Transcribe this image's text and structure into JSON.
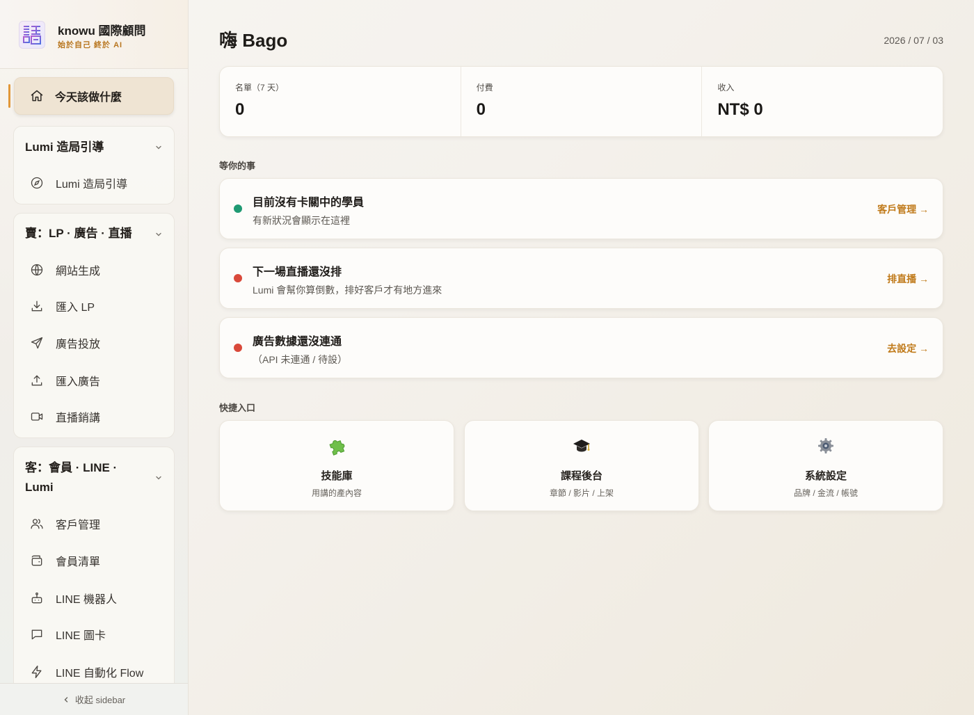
{
  "brand": {
    "logo_glyph": "譸",
    "name": "knowu 國際顧問",
    "tagline": "始於自己 終於 AI"
  },
  "sidebar": {
    "active_item": {
      "label": "今天該做什麼",
      "icon": "home-icon"
    },
    "groups": [
      {
        "title": "Lumi 造局引導",
        "items": [
          {
            "label": "Lumi 造局引導",
            "icon": "compass-icon"
          }
        ]
      },
      {
        "title": "賣：LP · 廣告 · 直播",
        "items": [
          {
            "label": "網站生成",
            "icon": "globe-icon"
          },
          {
            "label": "匯入 LP",
            "icon": "download-icon"
          },
          {
            "label": "廣告投放",
            "icon": "send-icon"
          },
          {
            "label": "匯入廣告",
            "icon": "upload-icon"
          },
          {
            "label": "直播銷講",
            "icon": "video-icon"
          }
        ]
      },
      {
        "title": "客：會員 · LINE · Lumi",
        "items": [
          {
            "label": "客戶管理",
            "icon": "users-icon"
          },
          {
            "label": "會員清單",
            "icon": "wallet-icon"
          },
          {
            "label": "LINE 機器人",
            "icon": "bot-icon"
          },
          {
            "label": "LINE 圖卡",
            "icon": "message-icon"
          },
          {
            "label": "LINE 自動化 Flow",
            "icon": "zap-icon"
          }
        ]
      }
    ],
    "collapse_label": "收起 sidebar"
  },
  "header": {
    "greeting": "嗨 Bago",
    "date": "2026 / 07 / 03"
  },
  "stats": [
    {
      "label": "名單（7 天）",
      "value": "0"
    },
    {
      "label": "付費",
      "value": "0"
    },
    {
      "label": "收入",
      "value": "NT$ 0"
    }
  ],
  "tasks_section_title": "等你的事",
  "tasks": [
    {
      "title": "目前沒有卡關中的學員",
      "subtitle": "有新狀況會顯示在這裡",
      "link": "客戶管理 →",
      "status_color": "#1f9a73"
    },
    {
      "title": "下一場直播還沒排",
      "subtitle": "Lumi 會幫你算倒數，排好客戶才有地方進來",
      "link": "排直播 →",
      "status_color": "#d9493a"
    },
    {
      "title": "廣告數據還沒連通",
      "subtitle": "（API 未連通 / 待設）",
      "link": "去設定 →",
      "status_color": "#d9493a"
    }
  ],
  "quick_section_title": "快捷入口",
  "quick_links": [
    {
      "title": "技能庫",
      "subtitle": "用講的產內容",
      "icon": "puzzle-icon"
    },
    {
      "title": "課程後台",
      "subtitle": "章節 / 影片 / 上架",
      "icon": "graduation-cap-icon"
    },
    {
      "title": "系統設定",
      "subtitle": "品牌 / 金流 / 帳號",
      "icon": "gear-icon"
    }
  ]
}
